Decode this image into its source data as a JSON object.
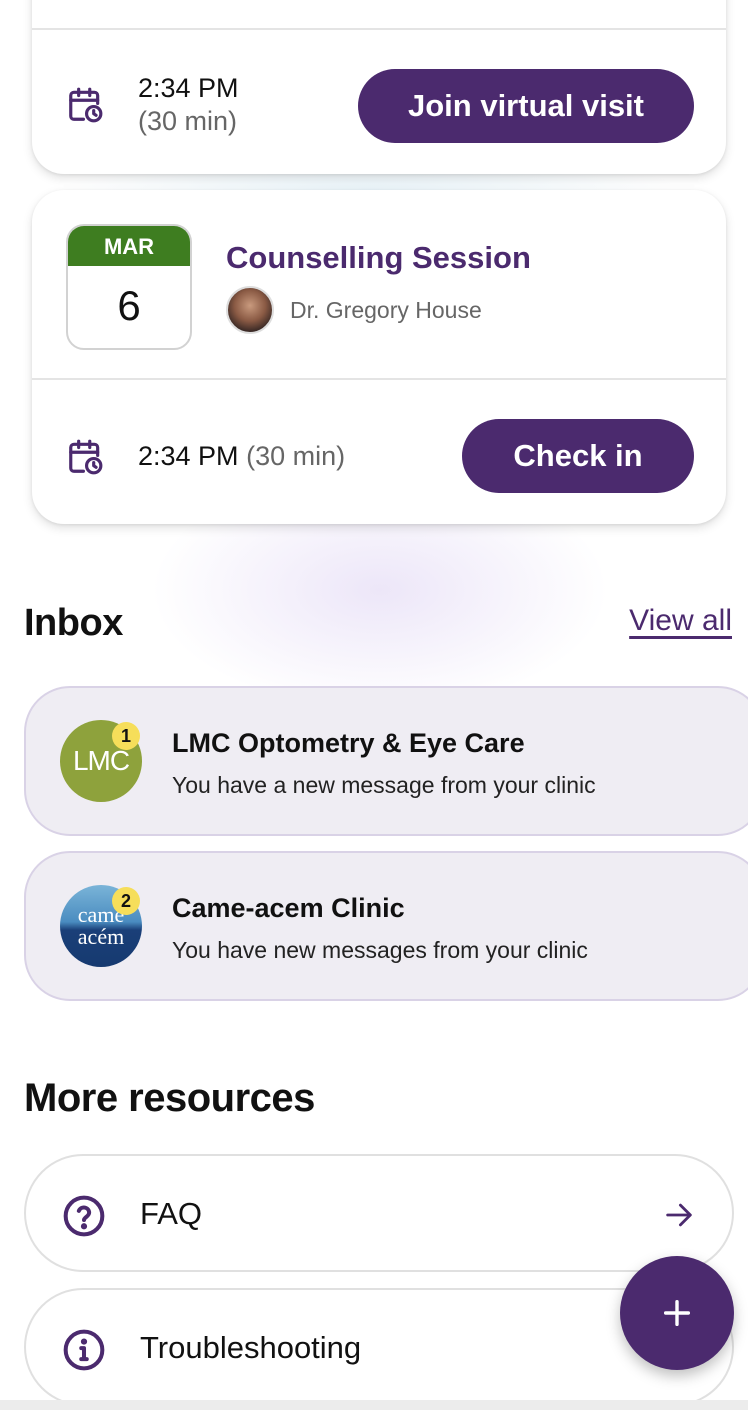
{
  "appointments": [
    {
      "time": "2:34 PM",
      "duration": "(30 min)",
      "action_label": "Join virtual visit"
    },
    {
      "month": "MAR",
      "day": "6",
      "title": "Counselling Session",
      "doctor": "Dr. Gregory House",
      "time": "2:34 PM",
      "duration": "(30 min)",
      "action_label": "Check in"
    }
  ],
  "inbox": {
    "title": "Inbox",
    "view_all": "View all",
    "items": [
      {
        "logo_text": "LMC",
        "badge": "1",
        "name": "LMC Optometry & Eye Care",
        "message": "You have a new message from your clinic"
      },
      {
        "logo_line1": "came",
        "logo_line2": "acém",
        "badge": "2",
        "name": "Came-acem Clinic",
        "message": "You have new messages from your clinic"
      }
    ]
  },
  "resources": {
    "title": "More resources",
    "items": [
      {
        "label": "FAQ",
        "icon": "question-circle-icon"
      },
      {
        "label": "Troubleshooting",
        "icon": "info-circle-icon"
      }
    ]
  },
  "fab": {
    "icon": "plus-icon"
  },
  "colors": {
    "brand": "#4b2a6e",
    "month_header": "#3e7d20",
    "badge": "#f6de5a",
    "inbox_bg": "#efedf3"
  }
}
